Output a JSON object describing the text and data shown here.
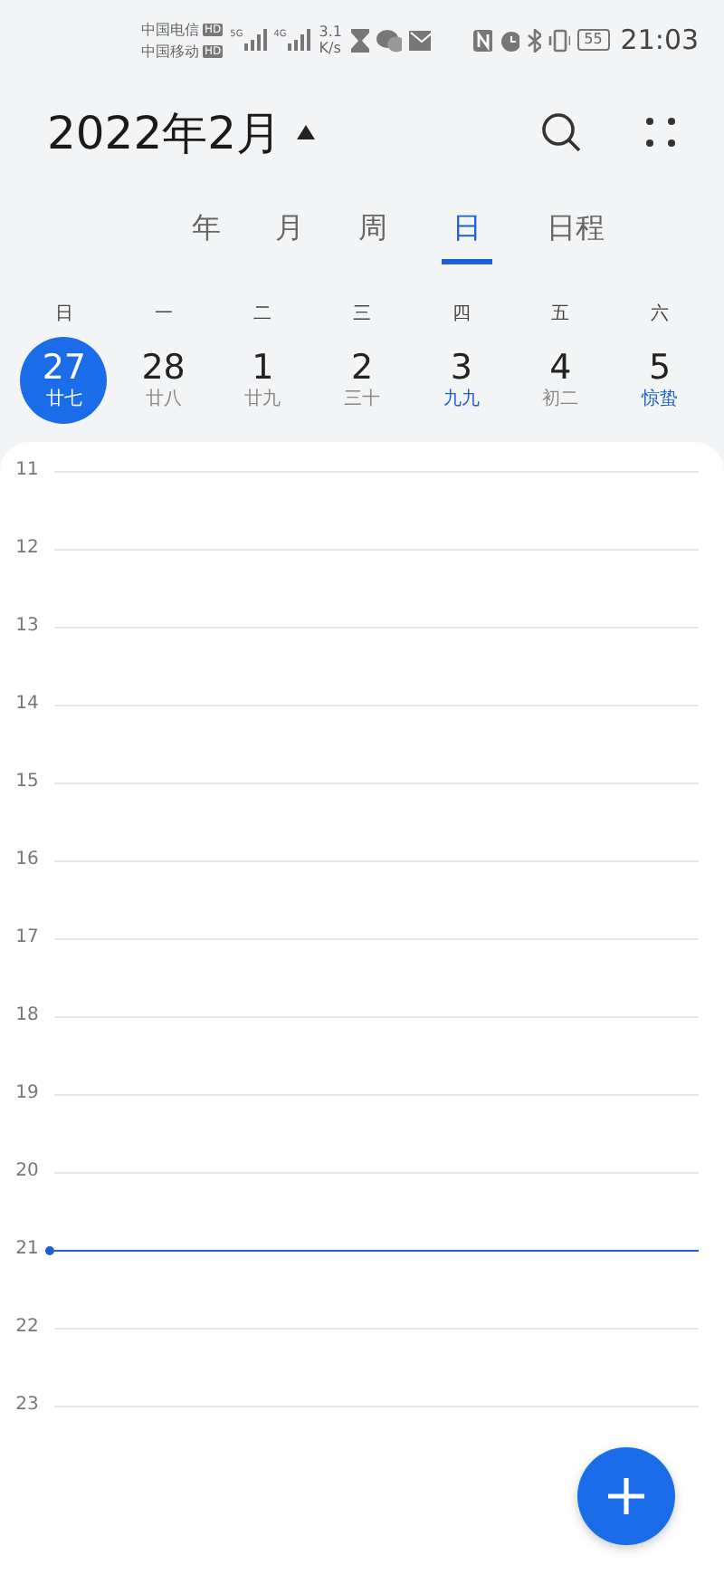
{
  "status_bar": {
    "carriers": [
      {
        "name": "中国电信",
        "badge": "HD",
        "network": "5G"
      },
      {
        "name": "中国移动",
        "badge": "HD",
        "network": "4G"
      }
    ],
    "speed_value": "3.1",
    "speed_unit": "K/s",
    "battery": "55",
    "time": "21:03"
  },
  "header": {
    "title": "2022年2月"
  },
  "tabs": [
    {
      "label": "年",
      "selected": false
    },
    {
      "label": "月",
      "selected": false
    },
    {
      "label": "周",
      "selected": false
    },
    {
      "label": "日",
      "selected": true
    },
    {
      "label": "日程",
      "selected": false
    }
  ],
  "week": [
    {
      "weekday": "日",
      "date": "27",
      "lunar": "廿七",
      "selected": true,
      "highlighted": false
    },
    {
      "weekday": "一",
      "date": "28",
      "lunar": "廿八",
      "selected": false,
      "highlighted": false
    },
    {
      "weekday": "二",
      "date": "1",
      "lunar": "廿九",
      "selected": false,
      "highlighted": false
    },
    {
      "weekday": "三",
      "date": "2",
      "lunar": "三十",
      "selected": false,
      "highlighted": false
    },
    {
      "weekday": "四",
      "date": "3",
      "lunar": "九九",
      "selected": false,
      "highlighted": true
    },
    {
      "weekday": "五",
      "date": "4",
      "lunar": "初二",
      "selected": false,
      "highlighted": false
    },
    {
      "weekday": "六",
      "date": "5",
      "lunar": "惊蛰",
      "selected": false,
      "highlighted": true
    }
  ],
  "hours": [
    {
      "label": "11",
      "current": false
    },
    {
      "label": "12",
      "current": false
    },
    {
      "label": "13",
      "current": false
    },
    {
      "label": "14",
      "current": false
    },
    {
      "label": "15",
      "current": false
    },
    {
      "label": "16",
      "current": false
    },
    {
      "label": "17",
      "current": false
    },
    {
      "label": "18",
      "current": false
    },
    {
      "label": "19",
      "current": false
    },
    {
      "label": "20",
      "current": false
    },
    {
      "label": "21",
      "current": true
    },
    {
      "label": "22",
      "current": false
    },
    {
      "label": "23",
      "current": false
    }
  ]
}
